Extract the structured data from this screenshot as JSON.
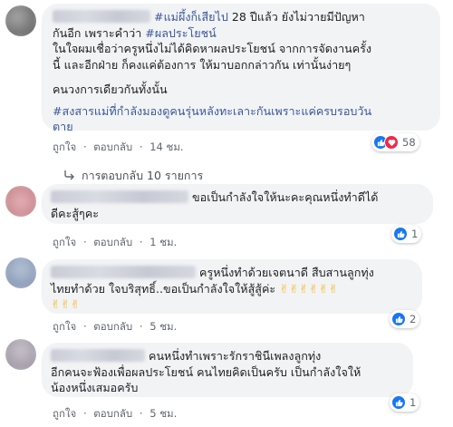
{
  "comments": [
    {
      "line1_tag": "#แม่ผึ้งก็เสียไป",
      "line1_text": " 28 ปีแล้ว ยังไม่วายมีปัญหา",
      "line2_text": "กันอีก เพราะคำว่า ",
      "line2_tag": "#ผลประโยชน์",
      "line3": "ในใจผมเชื่อว่าครูหนึ่งไม่ได้คิดหาผลประโยชน์ จากการจัดงานครั้ง",
      "line4": "นี้ และอีกฝ่าย ก็คงแค่ต้องการ ให้มาบอกกล่าวกัน เท่านั้นง่ายๆ",
      "line5": "คนวงการเดียวกันทั้งนั้น",
      "line6_tag": "#สงสารแม่ที่กำลังมองดูคนรุ่นหลังทะเลาะกันเพราะแค่ครบรอบวัน",
      "line7_tag": "ตาย",
      "actions": {
        "like": "ถูกใจ",
        "reply": "ตอบกลับ",
        "time": "14 ชม."
      },
      "reaction_count": "58"
    },
    {
      "line1": "ขอเป็นกำลังใจให้นะคะคุณหนึ่งทำดีได้",
      "line2": "ดีคะสู้ๆคะ",
      "actions": {
        "like": "ถูกใจ",
        "reply": "ตอบกลับ",
        "time": "1 ชม."
      },
      "reaction_count": "1"
    },
    {
      "line1": "ครูหนึ่งทำด้วยเจตนาดี สืบสานลูกทุ่ง",
      "line2": "ไทยทำด้วย ใจบริสุทธิ์..ขอเป็นกำลังใจให้สู้สู้ค่ะ",
      "emojis": "✌✌✌✌✌✌",
      "emojis2": "✌✌✌",
      "actions": {
        "like": "ถูกใจ",
        "reply": "ตอบกลับ",
        "time": "5 ชม."
      },
      "reaction_count": "2"
    },
    {
      "line1": "คนหนึ่งทำเพราะรักราชินีเพลงลูกทุ่ง",
      "line2": "อีกคนจะฟ้องเพื่อผลประโยชน์ คนไทยคิดเป็นครับ เป็นกำลังใจให้",
      "line3": "น้องหนึ่งเสมอครับ",
      "actions": {
        "like": "ถูกใจ",
        "reply": "ตอบกลับ",
        "time": "5 ชม."
      },
      "reaction_count": "1"
    }
  ],
  "replies_link": "การตอบกลับ 10 รายการ",
  "separator": "·",
  "icons": {
    "like": "like-icon",
    "love": "love-icon",
    "reply_arrow": "reply-arrow-icon"
  },
  "colors": {
    "link": "#385898",
    "like": "#1877f2",
    "love": "#f0284a",
    "bubble": "#f2f3f5"
  }
}
